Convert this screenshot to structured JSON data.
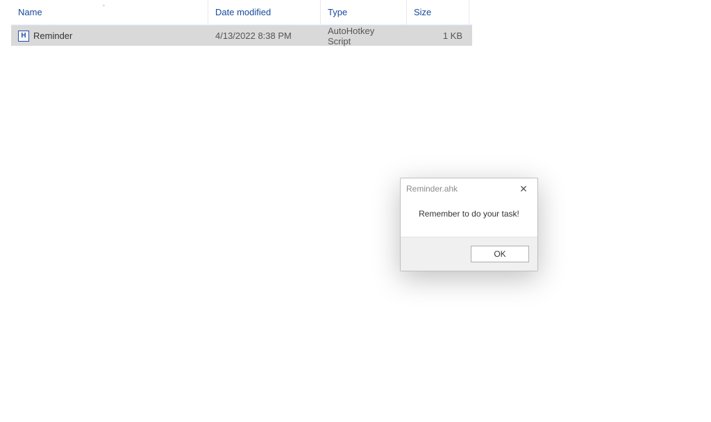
{
  "explorer": {
    "columns": {
      "name": "Name",
      "date": "Date modified",
      "type": "Type",
      "size": "Size"
    },
    "sort_indicator": "ˆ",
    "rows": [
      {
        "icon_letter": "H",
        "name": "Reminder",
        "date": "4/13/2022 8:38 PM",
        "type": "AutoHotkey Script",
        "size": "1 KB"
      }
    ]
  },
  "dialog": {
    "title": "Reminder.ahk",
    "message": "Remember to do your task!",
    "ok_label": "OK",
    "close_glyph": "✕"
  }
}
